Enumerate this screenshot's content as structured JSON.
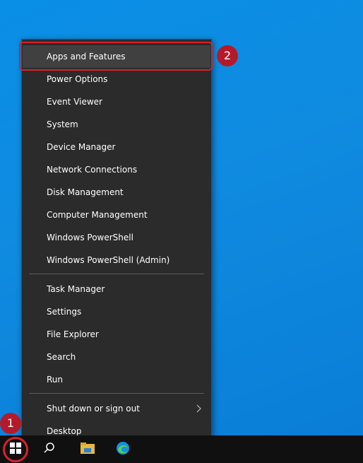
{
  "menu": {
    "items": [
      {
        "label": "Apps and Features"
      },
      {
        "label": "Power Options"
      },
      {
        "label": "Event Viewer"
      },
      {
        "label": "System"
      },
      {
        "label": "Device Manager"
      },
      {
        "label": "Network Connections"
      },
      {
        "label": "Disk Management"
      },
      {
        "label": "Computer Management"
      },
      {
        "label": "Windows PowerShell"
      },
      {
        "label": "Windows PowerShell (Admin)"
      },
      {
        "label": "Task Manager"
      },
      {
        "label": "Settings"
      },
      {
        "label": "File Explorer"
      },
      {
        "label": "Search"
      },
      {
        "label": "Run"
      },
      {
        "label": "Shut down or sign out"
      },
      {
        "label": "Desktop"
      }
    ],
    "highlighted_item": "Apps and Features"
  },
  "annotations": {
    "badge_1": "1",
    "badge_2": "2",
    "color": "#d9202b"
  },
  "taskbar": {
    "icons": [
      "windows-start-icon",
      "search-icon",
      "file-explorer-icon",
      "edge-icon"
    ]
  },
  "colors": {
    "desktop": "#0a8fe6",
    "menu_bg": "#2b2b2b",
    "taskbar": "#101010"
  }
}
